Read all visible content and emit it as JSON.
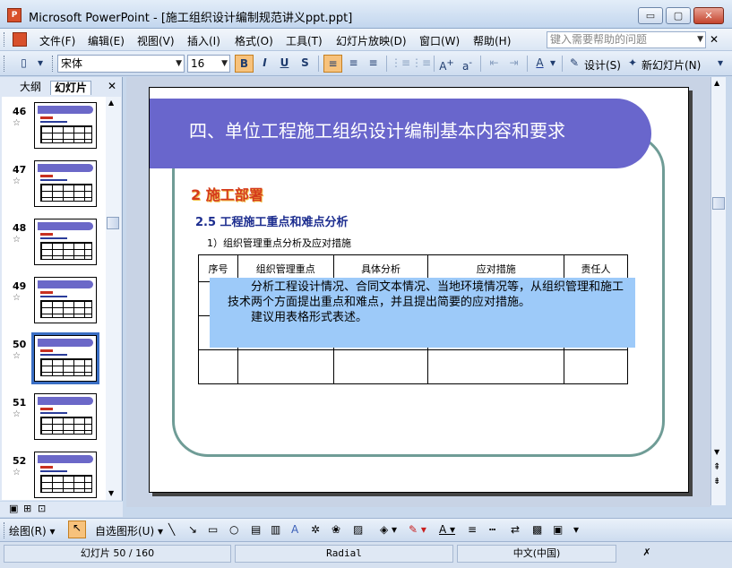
{
  "window": {
    "app_icon": "P",
    "title": "Microsoft PowerPoint - [施工组织设计编制规范讲义ppt.ppt]",
    "minimize_glyph": "▭",
    "maximize_glyph": "▢",
    "close_glyph": "✕"
  },
  "menu": {
    "items": [
      "文件(F)",
      "编辑(E)",
      "视图(V)",
      "插入(I)",
      "格式(O)",
      "工具(T)",
      "幻灯片放映(D)",
      "窗口(W)",
      "帮助(H)"
    ],
    "help_placeholder": "键入需要帮助的问题",
    "close_glyph": "✕"
  },
  "toolbar": {
    "font_name": "宋体",
    "font_size": "16",
    "bold": "B",
    "italic": "I",
    "underline": "U",
    "shadow": "S",
    "design_label": "设计(S)",
    "new_slide_label": "新幻灯片(N)"
  },
  "left_panel": {
    "tab_outline": "大纲",
    "tab_slides": "幻灯片",
    "close_glyph": "✕",
    "slides": [
      {
        "num": "46",
        "star": "☆"
      },
      {
        "num": "47",
        "star": "☆"
      },
      {
        "num": "48",
        "star": "☆"
      },
      {
        "num": "49",
        "star": "☆"
      },
      {
        "num": "50",
        "star": "☆"
      },
      {
        "num": "51",
        "star": "☆"
      },
      {
        "num": "52",
        "star": "☆"
      }
    ],
    "selected_slide": "50"
  },
  "slide": {
    "banner_title": "四、单位工程施工组织设计编制基本内容和要求",
    "section_title": "2  施工部署",
    "sub_title": "2.5 工程施工重点和难点分析",
    "point": "1）组织管理重点分析及应对措施",
    "table_headers": [
      "序号",
      "组织管理重点",
      "具体分析",
      "应对措施",
      "责任人"
    ],
    "overlay_line1": "分析工程设计情况、合同文本情况、当地环境情况等，从组织管理和施工技术两个方面提出重点和难点，并且提出简要的应对措施。",
    "overlay_line2": "建议用表格形式表述。",
    "colors": {
      "banner": "#6966cc",
      "section": "#d43a1c",
      "subtitle": "#1c2d8f",
      "overlay": "#9dcaf9",
      "frame": "#6f9c96"
    }
  },
  "drawbar": {
    "draw_label": "绘图(R)",
    "autoshapes_label": "自选图形(U)"
  },
  "status": {
    "slide_info": "幻灯片 50 / 160",
    "design": "Radial",
    "language": "中文(中国)"
  }
}
